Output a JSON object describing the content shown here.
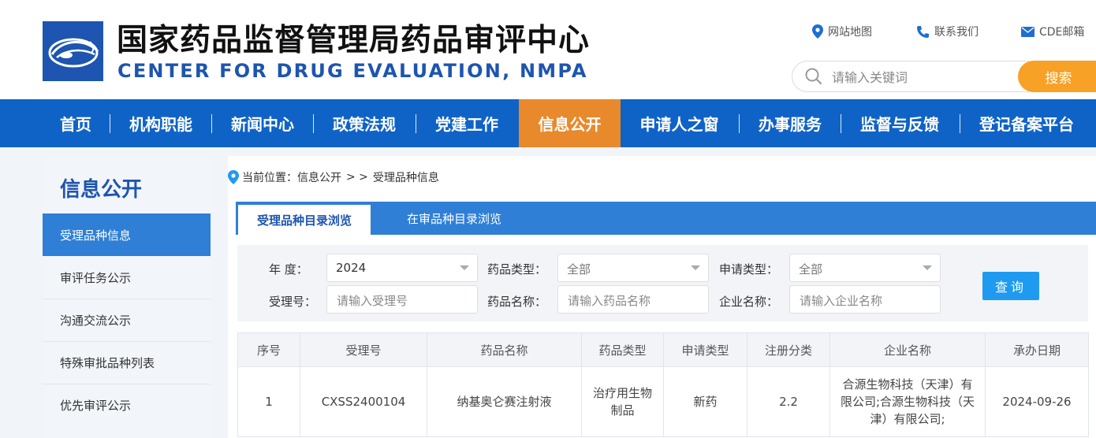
{
  "header": {
    "title_cn": "国家药品监督管理局药品审评中心",
    "title_en": "CENTER FOR DRUG EVALUATION, NMPA",
    "links": {
      "sitemap": "网站地图",
      "contact": "联系我们",
      "mail": "CDE邮箱"
    },
    "search": {
      "placeholder": "请输入关键词",
      "button": "搜索"
    }
  },
  "nav": {
    "items": [
      "首页",
      "机构职能",
      "新闻中心",
      "政策法规",
      "党建工作",
      "信息公开",
      "申请人之窗",
      "办事服务",
      "监督与反馈",
      "登记备案平台"
    ],
    "active": "信息公开"
  },
  "sidebar": {
    "title": "信息公开",
    "items": [
      "受理品种信息",
      "审评任务公示",
      "沟通交流公示",
      "特殊审批品种列表",
      "优先审评公示"
    ]
  },
  "breadcrumb": {
    "label": "当前位置：",
    "section": "信息公开",
    "sep": "> >",
    "current": "受理品种信息"
  },
  "tabs": [
    "受理品种目录浏览",
    "在审品种目录浏览"
  ],
  "filters": {
    "year_label": "年    度：",
    "year_value": "2024",
    "drug_type_label": "药品类型：",
    "drug_type_value": "全部",
    "app_type_label": "申请类型：",
    "app_type_value": "全部",
    "accept_no_label": "受理号：",
    "accept_no_placeholder": "请输入受理号",
    "drug_name_label": "药品名称：",
    "drug_name_placeholder": "请输入药品名称",
    "company_label": "企业名称：",
    "company_placeholder": "请输入企业名称",
    "query_button": "查询"
  },
  "table": {
    "headers": [
      "序号",
      "受理号",
      "药品名称",
      "药品类型",
      "申请类型",
      "注册分类",
      "企业名称",
      "承办日期"
    ],
    "rows": [
      [
        "1",
        "CXSS2400104",
        "纳基奥仑赛注射液",
        "治疗用生物制品",
        "新药",
        "2.2",
        "合源生物科技（天津）有限公司;合源生物科技（天津）有限公司;",
        "2024-09-26"
      ]
    ]
  },
  "colors": {
    "brand_blue": "#0f63c6",
    "active_orange": "#e8892c",
    "search_orange": "#f7a126",
    "tab_blue": "#2f7fd6"
  }
}
